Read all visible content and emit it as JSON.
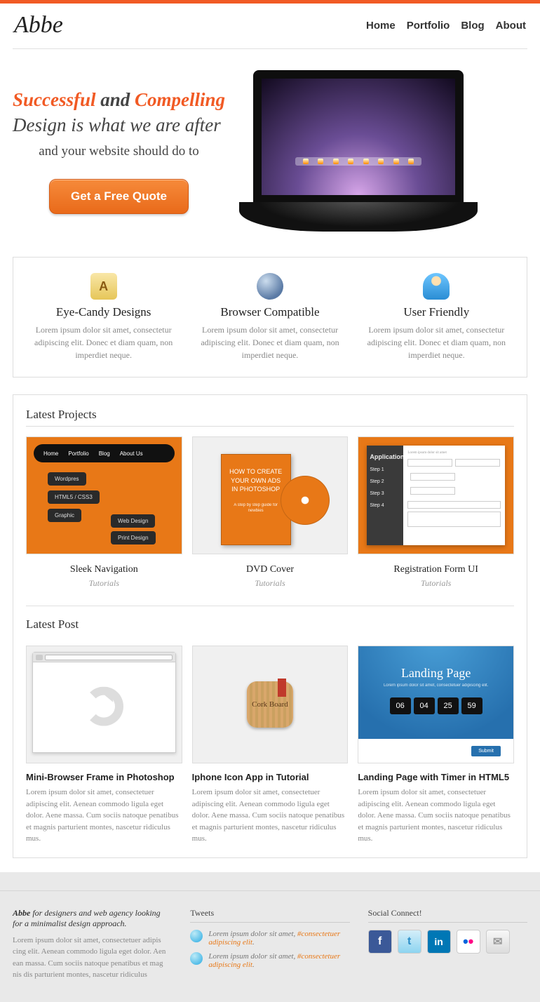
{
  "brand": "Abbe",
  "nav": [
    "Home",
    "Portfolio",
    "Blog",
    "About"
  ],
  "hero": {
    "w1": "Successful",
    "w2": "and",
    "w3": "Compelling",
    "line2": "Design is what we are after",
    "sub": "and your website should do to",
    "cta": "Get a Free Quote"
  },
  "features": [
    {
      "title": "Eye-Candy Designs",
      "text": "Lorem ipsum dolor sit amet, consectetur adipiscing elit. Donec et diam quam, non imperdiet neque."
    },
    {
      "title": "Browser Compatible",
      "text": "Lorem ipsum dolor sit amet, consectetur adipiscing elit. Donec et diam quam, non imperdiet neque."
    },
    {
      "title": "User Friendly",
      "text": "Lorem ipsum dolor sit amet, consectetur adipiscing elit. Donec et diam quam, non imperdiet neque."
    }
  ],
  "projects": {
    "heading": "Latest Projects",
    "nav_items": [
      "Home",
      "Portfolio",
      "Blog",
      "About Us"
    ],
    "pills": [
      "Wordpres",
      "HTML5 / CSS3",
      "Graphic",
      "Web Design",
      "Print Design"
    ],
    "dvd_text": "HOW TO CREATE YOUR OWN ADS IN PHOTOSHOP",
    "dvd_sub": "A step by step guide for newbies",
    "form_header": "Application",
    "steps": [
      "Step 1",
      "Step 2",
      "Step 3",
      "Step 4"
    ],
    "items": [
      {
        "title": "Sleek Navigation",
        "cat": "Tutorials"
      },
      {
        "title": "DVD Cover",
        "cat": "Tutorials"
      },
      {
        "title": "Registration Form UI",
        "cat": "Tutorials"
      }
    ]
  },
  "posts": {
    "heading": "Latest Post",
    "landing_title": "Landing Page",
    "landing_sub": "Lorem ipsum dolor sit amet, consectetuer adipiscing elit.",
    "timer": [
      "06",
      "04",
      "25",
      "59"
    ],
    "submit": "Submit",
    "cork": "Cork Board",
    "items": [
      {
        "title": "Mini-Browser Frame in Photoshop",
        "text": "Lorem ipsum dolor sit amet, consectetuer adipiscing elit. Aenean commodo ligula eget dolor. Aene massa. Cum sociis natoque penatibus et magnis parturient montes, nascetur ridiculus mus."
      },
      {
        "title": "Iphone Icon App in Tutorial",
        "text": "Lorem ipsum dolor sit amet, consectetuer adipiscing elit. Aenean commodo ligula eget dolor. Aene massa. Cum sociis natoque penatibus et magnis parturient montes, nascetur ridiculus mus."
      },
      {
        "title": "Landing Page with Timer in HTML5",
        "text": "Lorem ipsum dolor sit amet, consectetuer adipiscing elit. Aenean commodo ligula eget dolor. Aene massa. Cum sociis natoque penatibus et magnis parturient montes, nascetur ridiculus mus."
      }
    ]
  },
  "footer": {
    "about_bold": "Abbe",
    "about_rest": " for designers and web agency looking for a minimalist design approach.",
    "about_text": "Lorem ipsum dolor sit amet, consectetuer adipis cing elit. Aenean commodo ligula eget dolor. Aen ean massa. Cum sociis natoque penatibus et mag nis dis parturient montes, nascetur ridiculus",
    "tweets_h": "Tweets",
    "tweet_text": "Lorem ipsum dolor sit amet, ",
    "tweet_link": "#consectetuer adipiscing elit",
    "social_h": "Social Connect!"
  }
}
